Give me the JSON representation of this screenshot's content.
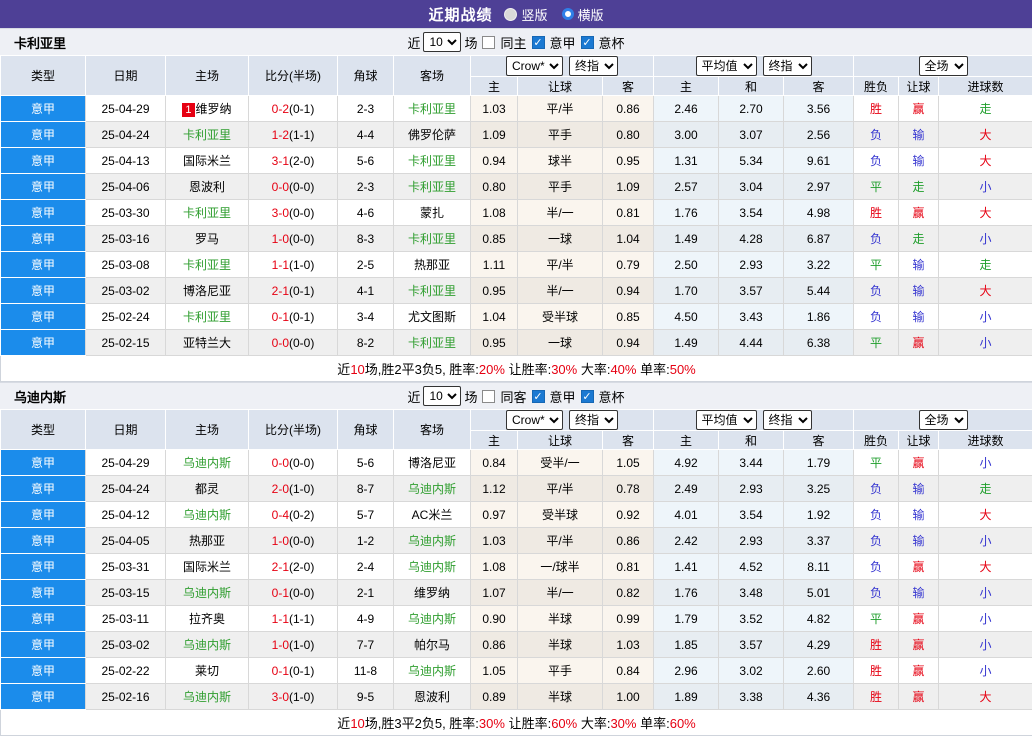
{
  "topbar": {
    "title": "近期战绩",
    "options": [
      {
        "label": "竖版",
        "selected": true
      },
      {
        "label": "横版",
        "selected": false
      }
    ]
  },
  "table_meta": {
    "main_headers": [
      "类型",
      "日期",
      "主场",
      "比分(半场)",
      "角球",
      "客场"
    ],
    "sub_headers": [
      "主",
      "让球",
      "客",
      "主",
      "和",
      "客",
      "胜负",
      "让球",
      "进球数"
    ],
    "selects": {
      "odds_company": "Crow*",
      "odds_stage": "终指",
      "avg_source": "平均值",
      "avg_stage": "终指",
      "scope": "全场"
    },
    "filter": {
      "near_label": "近",
      "games_label": "场",
      "league_label": "意甲",
      "cup_label": "意杯"
    }
  },
  "sections": [
    {
      "team": "卡利亚里",
      "filter": {
        "count": "10",
        "same_label": "同主",
        "same_checked": false,
        "league_checked": true,
        "cup_checked": true
      },
      "rows": [
        {
          "league": "意甲",
          "date": "25-04-29",
          "home": "维罗纳",
          "home_badge": "1",
          "home_team": false,
          "score": "0-2",
          "half": "(0-1)",
          "corners": "2-3",
          "away": "卡利亚里",
          "away_team": true,
          "odds": [
            "1.03",
            "平/半",
            "0.86"
          ],
          "avg": [
            "2.46",
            "2.70",
            "3.56"
          ],
          "results": [
            "胜",
            "赢",
            "走"
          ]
        },
        {
          "league": "意甲",
          "date": "25-04-24",
          "home": "卡利亚里",
          "home_team": true,
          "score": "1-2",
          "half": "(1-1)",
          "corners": "4-4",
          "away": "佛罗伦萨",
          "away_team": false,
          "odds": [
            "1.09",
            "平手",
            "0.80"
          ],
          "avg": [
            "3.00",
            "3.07",
            "2.56"
          ],
          "results": [
            "负",
            "输",
            "大"
          ]
        },
        {
          "league": "意甲",
          "date": "25-04-13",
          "home": "国际米兰",
          "home_team": false,
          "score": "3-1",
          "half": "(2-0)",
          "corners": "5-6",
          "away": "卡利亚里",
          "away_team": true,
          "odds": [
            "0.94",
            "球半",
            "0.95"
          ],
          "avg": [
            "1.31",
            "5.34",
            "9.61"
          ],
          "results": [
            "负",
            "输",
            "大"
          ]
        },
        {
          "league": "意甲",
          "date": "25-04-06",
          "home": "恩波利",
          "home_team": false,
          "score": "0-0",
          "half": "(0-0)",
          "corners": "2-3",
          "away": "卡利亚里",
          "away_team": true,
          "odds": [
            "0.80",
            "平手",
            "1.09"
          ],
          "avg": [
            "2.57",
            "3.04",
            "2.97"
          ],
          "results": [
            "平",
            "走",
            "小"
          ]
        },
        {
          "league": "意甲",
          "date": "25-03-30",
          "home": "卡利亚里",
          "home_team": true,
          "score": "3-0",
          "half": "(0-0)",
          "corners": "4-6",
          "away": "蒙扎",
          "away_team": false,
          "odds": [
            "1.08",
            "半/一",
            "0.81"
          ],
          "avg": [
            "1.76",
            "3.54",
            "4.98"
          ],
          "results": [
            "胜",
            "赢",
            "大"
          ]
        },
        {
          "league": "意甲",
          "date": "25-03-16",
          "home": "罗马",
          "home_team": false,
          "score": "1-0",
          "half": "(0-0)",
          "corners": "8-3",
          "away": "卡利亚里",
          "away_team": true,
          "odds": [
            "0.85",
            "一球",
            "1.04"
          ],
          "avg": [
            "1.49",
            "4.28",
            "6.87"
          ],
          "results": [
            "负",
            "走",
            "小"
          ]
        },
        {
          "league": "意甲",
          "date": "25-03-08",
          "home": "卡利亚里",
          "home_team": true,
          "score": "1-1",
          "half": "(1-0)",
          "corners": "2-5",
          "away": "热那亚",
          "away_team": false,
          "odds": [
            "1.11",
            "平/半",
            "0.79"
          ],
          "avg": [
            "2.50",
            "2.93",
            "3.22"
          ],
          "results": [
            "平",
            "输",
            "走"
          ]
        },
        {
          "league": "意甲",
          "date": "25-03-02",
          "home": "博洛尼亚",
          "home_team": false,
          "score": "2-1",
          "half": "(0-1)",
          "corners": "4-1",
          "away": "卡利亚里",
          "away_team": true,
          "odds": [
            "0.95",
            "半/一",
            "0.94"
          ],
          "avg": [
            "1.70",
            "3.57",
            "5.44"
          ],
          "results": [
            "负",
            "输",
            "大"
          ]
        },
        {
          "league": "意甲",
          "date": "25-02-24",
          "home": "卡利亚里",
          "home_team": true,
          "score": "0-1",
          "half": "(0-1)",
          "corners": "3-4",
          "away": "尤文图斯",
          "away_team": false,
          "odds": [
            "1.04",
            "受半球",
            "0.85"
          ],
          "avg": [
            "4.50",
            "3.43",
            "1.86"
          ],
          "results": [
            "负",
            "输",
            "小"
          ]
        },
        {
          "league": "意甲",
          "date": "25-02-15",
          "home": "亚特兰大",
          "home_team": false,
          "score": "0-0",
          "half": "(0-0)",
          "corners": "8-2",
          "away": "卡利亚里",
          "away_team": true,
          "odds": [
            "0.95",
            "一球",
            "0.94"
          ],
          "avg": [
            "1.49",
            "4.44",
            "6.38"
          ],
          "results": [
            "平",
            "赢",
            "小"
          ]
        }
      ],
      "summary": [
        [
          "近",
          0
        ],
        [
          "10",
          1
        ],
        [
          "场,胜2平3负5, 胜率:",
          0
        ],
        [
          "20%",
          1
        ],
        [
          " 让胜率:",
          0
        ],
        [
          "30%",
          1
        ],
        [
          " 大率:",
          0
        ],
        [
          "40%",
          1
        ],
        [
          " 单率:",
          0
        ],
        [
          "50%",
          1
        ]
      ]
    },
    {
      "team": "乌迪内斯",
      "filter": {
        "count": "10",
        "same_label": "同客",
        "same_checked": false,
        "league_checked": true,
        "cup_checked": true
      },
      "rows": [
        {
          "league": "意甲",
          "date": "25-04-29",
          "home": "乌迪内斯",
          "home_team": true,
          "score": "0-0",
          "half": "(0-0)",
          "corners": "5-6",
          "away": "博洛尼亚",
          "away_team": false,
          "odds": [
            "0.84",
            "受半/一",
            "1.05"
          ],
          "avg": [
            "4.92",
            "3.44",
            "1.79"
          ],
          "results": [
            "平",
            "赢",
            "小"
          ]
        },
        {
          "league": "意甲",
          "date": "25-04-24",
          "home": "都灵",
          "home_team": false,
          "score": "2-0",
          "half": "(1-0)",
          "corners": "8-7",
          "away": "乌迪内斯",
          "away_team": true,
          "odds": [
            "1.12",
            "平/半",
            "0.78"
          ],
          "avg": [
            "2.49",
            "2.93",
            "3.25"
          ],
          "results": [
            "负",
            "输",
            "走"
          ]
        },
        {
          "league": "意甲",
          "date": "25-04-12",
          "home": "乌迪内斯",
          "home_team": true,
          "score": "0-4",
          "half": "(0-2)",
          "corners": "5-7",
          "away": "AC米兰",
          "away_team": false,
          "odds": [
            "0.97",
            "受半球",
            "0.92"
          ],
          "avg": [
            "4.01",
            "3.54",
            "1.92"
          ],
          "results": [
            "负",
            "输",
            "大"
          ]
        },
        {
          "league": "意甲",
          "date": "25-04-05",
          "home": "热那亚",
          "home_team": false,
          "score": "1-0",
          "half": "(0-0)",
          "corners": "1-2",
          "away": "乌迪内斯",
          "away_team": true,
          "odds": [
            "1.03",
            "平/半",
            "0.86"
          ],
          "avg": [
            "2.42",
            "2.93",
            "3.37"
          ],
          "results": [
            "负",
            "输",
            "小"
          ]
        },
        {
          "league": "意甲",
          "date": "25-03-31",
          "home": "国际米兰",
          "home_team": false,
          "score": "2-1",
          "half": "(2-0)",
          "corners": "2-4",
          "away": "乌迪内斯",
          "away_team": true,
          "odds": [
            "1.08",
            "一/球半",
            "0.81"
          ],
          "avg": [
            "1.41",
            "4.52",
            "8.11"
          ],
          "results": [
            "负",
            "赢",
            "大"
          ]
        },
        {
          "league": "意甲",
          "date": "25-03-15",
          "home": "乌迪内斯",
          "home_team": true,
          "score": "0-1",
          "half": "(0-0)",
          "corners": "2-1",
          "away": "维罗纳",
          "away_team": false,
          "odds": [
            "1.07",
            "半/一",
            "0.82"
          ],
          "avg": [
            "1.76",
            "3.48",
            "5.01"
          ],
          "results": [
            "负",
            "输",
            "小"
          ]
        },
        {
          "league": "意甲",
          "date": "25-03-11",
          "home": "拉齐奥",
          "home_team": false,
          "score": "1-1",
          "half": "(1-1)",
          "corners": "4-9",
          "away": "乌迪内斯",
          "away_team": true,
          "odds": [
            "0.90",
            "半球",
            "0.99"
          ],
          "avg": [
            "1.79",
            "3.52",
            "4.82"
          ],
          "results": [
            "平",
            "赢",
            "小"
          ]
        },
        {
          "league": "意甲",
          "date": "25-03-02",
          "home": "乌迪内斯",
          "home_team": true,
          "score": "1-0",
          "half": "(1-0)",
          "corners": "7-7",
          "away": "帕尔马",
          "away_team": false,
          "odds": [
            "0.86",
            "半球",
            "1.03"
          ],
          "avg": [
            "1.85",
            "3.57",
            "4.29"
          ],
          "results": [
            "胜",
            "赢",
            "小"
          ]
        },
        {
          "league": "意甲",
          "date": "25-02-22",
          "home": "莱切",
          "home_team": false,
          "score": "0-1",
          "half": "(0-1)",
          "corners": "11-8",
          "away": "乌迪内斯",
          "away_team": true,
          "odds": [
            "1.05",
            "平手",
            "0.84"
          ],
          "avg": [
            "2.96",
            "3.02",
            "2.60"
          ],
          "results": [
            "胜",
            "赢",
            "小"
          ]
        },
        {
          "league": "意甲",
          "date": "25-02-16",
          "home": "乌迪内斯",
          "home_team": true,
          "score": "3-0",
          "half": "(1-0)",
          "corners": "9-5",
          "away": "恩波利",
          "away_team": false,
          "odds": [
            "0.89",
            "半球",
            "1.00"
          ],
          "avg": [
            "1.89",
            "3.38",
            "4.36"
          ],
          "results": [
            "胜",
            "赢",
            "大"
          ]
        }
      ],
      "summary": [
        [
          "近",
          0
        ],
        [
          "10",
          1
        ],
        [
          "场,胜3平2负5, 胜率:",
          0
        ],
        [
          "30%",
          1
        ],
        [
          " 让胜率:",
          0
        ],
        [
          "60%",
          1
        ],
        [
          " 大率:",
          0
        ],
        [
          "30%",
          1
        ],
        [
          " 单率:",
          0
        ],
        [
          "60%",
          1
        ]
      ]
    }
  ]
}
